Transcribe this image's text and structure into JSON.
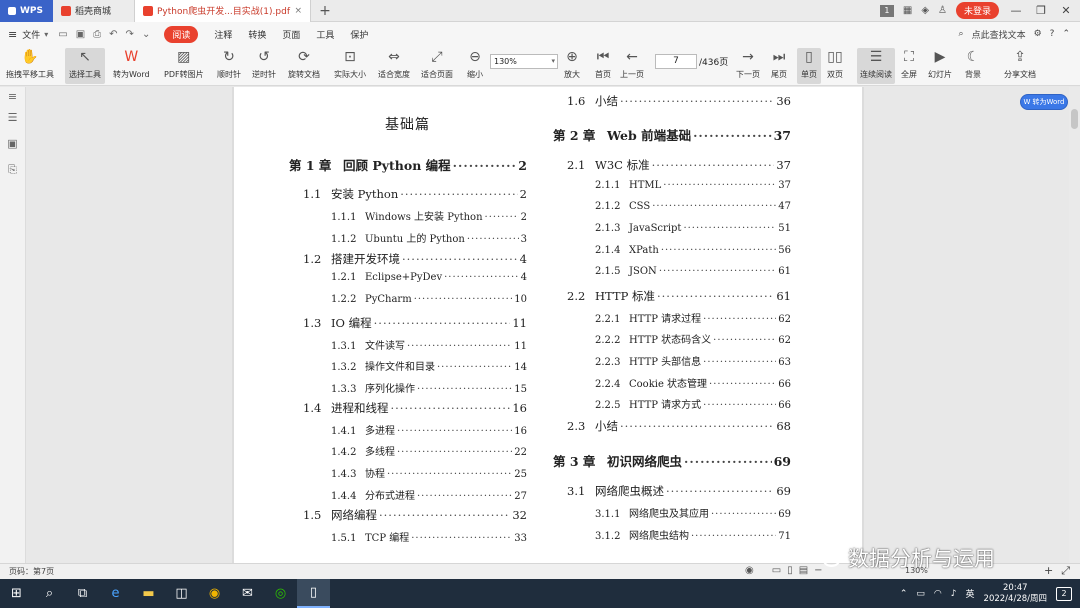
{
  "titlebar": {
    "app_tab": "WPS",
    "mall_tab": "稻壳商城",
    "doc_tab": "Python爬虫开发...目实战(1).pdf",
    "new_tab": "+",
    "count_badge": "1",
    "login": "未登录"
  },
  "menu": {
    "file": "文件",
    "read": "阅读",
    "items": [
      "注释",
      "转换",
      "页面",
      "工具",
      "保护"
    ],
    "search": "点此查找文本"
  },
  "toolbar": {
    "tools": [
      {
        "label": "拖拽平移工具",
        "icon": "hand-icon"
      },
      {
        "label": "选择工具",
        "icon": "cursor-icon"
      },
      {
        "label": "转为Word",
        "icon": "word-icon"
      },
      {
        "label": "PDF转图片",
        "icon": "image-icon"
      },
      {
        "label": "顺时针",
        "icon": "rotate-cw-icon"
      },
      {
        "label": "逆时针",
        "icon": "rotate-ccw-icon"
      },
      {
        "label": "旋转文档",
        "icon": "rotate-doc-icon"
      },
      {
        "label": "实际大小",
        "icon": "actual-size-icon"
      },
      {
        "label": "适合宽度",
        "icon": "fit-width-icon"
      },
      {
        "label": "适合页面",
        "icon": "fit-page-icon"
      },
      {
        "label": "缩小",
        "icon": "zoom-out-icon"
      },
      {
        "label": "放大",
        "icon": "zoom-in-icon"
      },
      {
        "label": "首页",
        "icon": "first-page-icon"
      },
      {
        "label": "上一页",
        "icon": "prev-page-icon"
      },
      {
        "label": "下一页",
        "icon": "next-page-icon"
      },
      {
        "label": "尾页",
        "icon": "last-page-icon"
      },
      {
        "label": "单页",
        "icon": "single-page-icon"
      },
      {
        "label": "双页",
        "icon": "double-page-icon"
      },
      {
        "label": "连续阅读",
        "icon": "continuous-icon"
      },
      {
        "label": "全屏",
        "icon": "fullscreen-icon"
      },
      {
        "label": "幻灯片",
        "icon": "slideshow-icon"
      },
      {
        "label": "背景",
        "icon": "background-icon"
      },
      {
        "label": "分享文档",
        "icon": "share-icon"
      }
    ],
    "zoom": "130%",
    "page_current": "7",
    "page_total": "/436页"
  },
  "side_button": "转为Word",
  "document": {
    "heading": "基础篇",
    "left_column": [
      {
        "level": "chapter",
        "num": "第 1 章",
        "title": "回顾 Python 编程",
        "page": "2"
      },
      {
        "level": "section",
        "num": "1.1",
        "title": "安装 Python",
        "page": "2"
      },
      {
        "level": "sub",
        "num": "1.1.1",
        "title": "Windows 上安装 Python",
        "page": "2"
      },
      {
        "level": "sub",
        "num": "1.1.2",
        "title": "Ubuntu 上的 Python",
        "page": "3"
      },
      {
        "level": "section",
        "num": "1.2",
        "title": "搭建开发环境",
        "page": "4"
      },
      {
        "level": "sub",
        "num": "1.2.1",
        "title": "Eclipse+PyDev",
        "page": "4"
      },
      {
        "level": "sub",
        "num": "1.2.2",
        "title": "PyCharm",
        "page": "10"
      },
      {
        "level": "section",
        "num": "1.3",
        "title": "IO 编程",
        "page": "11"
      },
      {
        "level": "sub",
        "num": "1.3.1",
        "title": "文件读写",
        "page": "11"
      },
      {
        "level": "sub",
        "num": "1.3.2",
        "title": "操作文件和目录",
        "page": "14"
      },
      {
        "level": "sub",
        "num": "1.3.3",
        "title": "序列化操作",
        "page": "15"
      },
      {
        "level": "section",
        "num": "1.4",
        "title": "进程和线程",
        "page": "16"
      },
      {
        "level": "sub",
        "num": "1.4.1",
        "title": "多进程",
        "page": "16"
      },
      {
        "level": "sub",
        "num": "1.4.2",
        "title": "多线程",
        "page": "22"
      },
      {
        "level": "sub",
        "num": "1.4.3",
        "title": "协程",
        "page": "25"
      },
      {
        "level": "sub",
        "num": "1.4.4",
        "title": "分布式进程",
        "page": "27"
      },
      {
        "level": "section",
        "num": "1.5",
        "title": "网络编程",
        "page": "32"
      },
      {
        "level": "sub",
        "num": "1.5.1",
        "title": "TCP 编程",
        "page": "33"
      }
    ],
    "right_column": [
      {
        "level": "section",
        "num": "1.6",
        "title": "小结",
        "page": "36"
      },
      {
        "level": "chapter",
        "num": "第 2 章",
        "title": "Web 前端基础",
        "page": "37"
      },
      {
        "level": "section",
        "num": "2.1",
        "title": "W3C 标准",
        "page": "37"
      },
      {
        "level": "sub",
        "num": "2.1.1",
        "title": "HTML",
        "page": "37"
      },
      {
        "level": "sub",
        "num": "2.1.2",
        "title": "CSS",
        "page": "47"
      },
      {
        "level": "sub",
        "num": "2.1.3",
        "title": "JavaScript",
        "page": "51"
      },
      {
        "level": "sub",
        "num": "2.1.4",
        "title": "XPath",
        "page": "56"
      },
      {
        "level": "sub",
        "num": "2.1.5",
        "title": "JSON",
        "page": "61"
      },
      {
        "level": "section",
        "num": "2.2",
        "title": "HTTP 标准",
        "page": "61"
      },
      {
        "level": "sub",
        "num": "2.2.1",
        "title": "HTTP 请求过程",
        "page": "62"
      },
      {
        "level": "sub",
        "num": "2.2.2",
        "title": "HTTP 状态码含义",
        "page": "62"
      },
      {
        "level": "sub",
        "num": "2.2.3",
        "title": "HTTP 头部信息",
        "page": "63"
      },
      {
        "level": "sub",
        "num": "2.2.4",
        "title": "Cookie 状态管理",
        "page": "66"
      },
      {
        "level": "sub",
        "num": "2.2.5",
        "title": "HTTP 请求方式",
        "page": "66"
      },
      {
        "level": "section",
        "num": "2.3",
        "title": "小结",
        "page": "68"
      },
      {
        "level": "chapter",
        "num": "第 3 章",
        "title": "初识网络爬虫",
        "page": "69"
      },
      {
        "level": "section",
        "num": "3.1",
        "title": "网络爬虫概述",
        "page": "69"
      },
      {
        "level": "sub",
        "num": "3.1.1",
        "title": "网络爬虫及其应用",
        "page": "69"
      },
      {
        "level": "sub",
        "num": "3.1.2",
        "title": "网络爬虫结构",
        "page": "71"
      }
    ]
  },
  "status": {
    "page_label": "页码：第7页",
    "zoom": "130%"
  },
  "watermark": "数据分析与运用",
  "taskbar": {
    "lang": "英",
    "time": "20:47",
    "date": "2022/4/28/周四",
    "notifications": "2"
  }
}
